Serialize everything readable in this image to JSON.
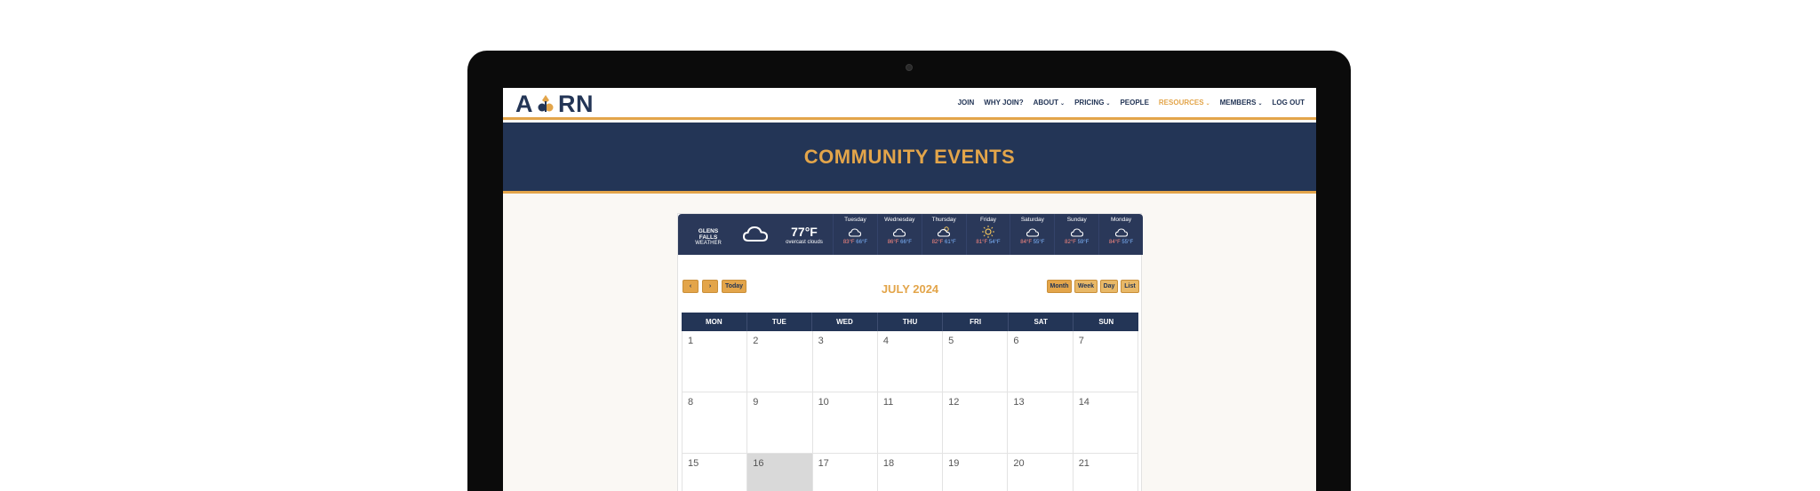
{
  "header": {
    "logo_text_left": "A",
    "logo_text_right": "RN",
    "nav": [
      {
        "label": "JOIN",
        "dropdown": false,
        "active": false
      },
      {
        "label": "WHY JOIN?",
        "dropdown": false,
        "active": false
      },
      {
        "label": "ABOUT",
        "dropdown": true,
        "active": false
      },
      {
        "label": "PRICING",
        "dropdown": true,
        "active": false
      },
      {
        "label": "PEOPLE",
        "dropdown": false,
        "active": false
      },
      {
        "label": "RESOURCES",
        "dropdown": true,
        "active": true
      },
      {
        "label": "MEMBERS",
        "dropdown": true,
        "active": false
      },
      {
        "label": "LOG OUT",
        "dropdown": false,
        "active": false
      }
    ],
    "caret_glyph": "⌄"
  },
  "banner": {
    "title": "COMMUNITY EVENTS"
  },
  "weather": {
    "city": "GLENS FALLS",
    "label": "WEATHER",
    "current_temp": "77°F",
    "current_desc": "overcast clouds",
    "current_icon": "cloud-icon",
    "days": [
      {
        "name": "Tuesday",
        "icon": "cloud-icon",
        "hi": "83°F",
        "lo": "66°F"
      },
      {
        "name": "Wednesday",
        "icon": "cloud-icon",
        "hi": "86°F",
        "lo": "66°F"
      },
      {
        "name": "Thursday",
        "icon": "partly-cloudy-icon",
        "hi": "82°F",
        "lo": "61°F"
      },
      {
        "name": "Friday",
        "icon": "sun-icon",
        "hi": "81°F",
        "lo": "54°F"
      },
      {
        "name": "Saturday",
        "icon": "cloud-icon",
        "hi": "84°F",
        "lo": "55°F"
      },
      {
        "name": "Sunday",
        "icon": "cloud-icon",
        "hi": "82°F",
        "lo": "59°F"
      },
      {
        "name": "Monday",
        "icon": "cloud-icon",
        "hi": "84°F",
        "lo": "55°F"
      }
    ]
  },
  "toolbar": {
    "prev_label": "‹",
    "next_label": "›",
    "today_label": "Today",
    "title": "JULY 2024",
    "month_label": "Month",
    "week_label": "Week",
    "day_label": "Day",
    "list_label": "List"
  },
  "calendar": {
    "weekdays": [
      "MON",
      "TUE",
      "WED",
      "THU",
      "FRI",
      "SAT",
      "SUN"
    ],
    "weeks": [
      [
        "1",
        "2",
        "3",
        "4",
        "5",
        "6",
        "7"
      ],
      [
        "8",
        "9",
        "10",
        "11",
        "12",
        "13",
        "14"
      ],
      [
        "15",
        "16",
        "17",
        "18",
        "19",
        "20",
        "21"
      ]
    ],
    "today": "16"
  },
  "colors": {
    "navy": "#233556",
    "gold": "#e3a54a",
    "weather_bg": "#2a3859"
  }
}
